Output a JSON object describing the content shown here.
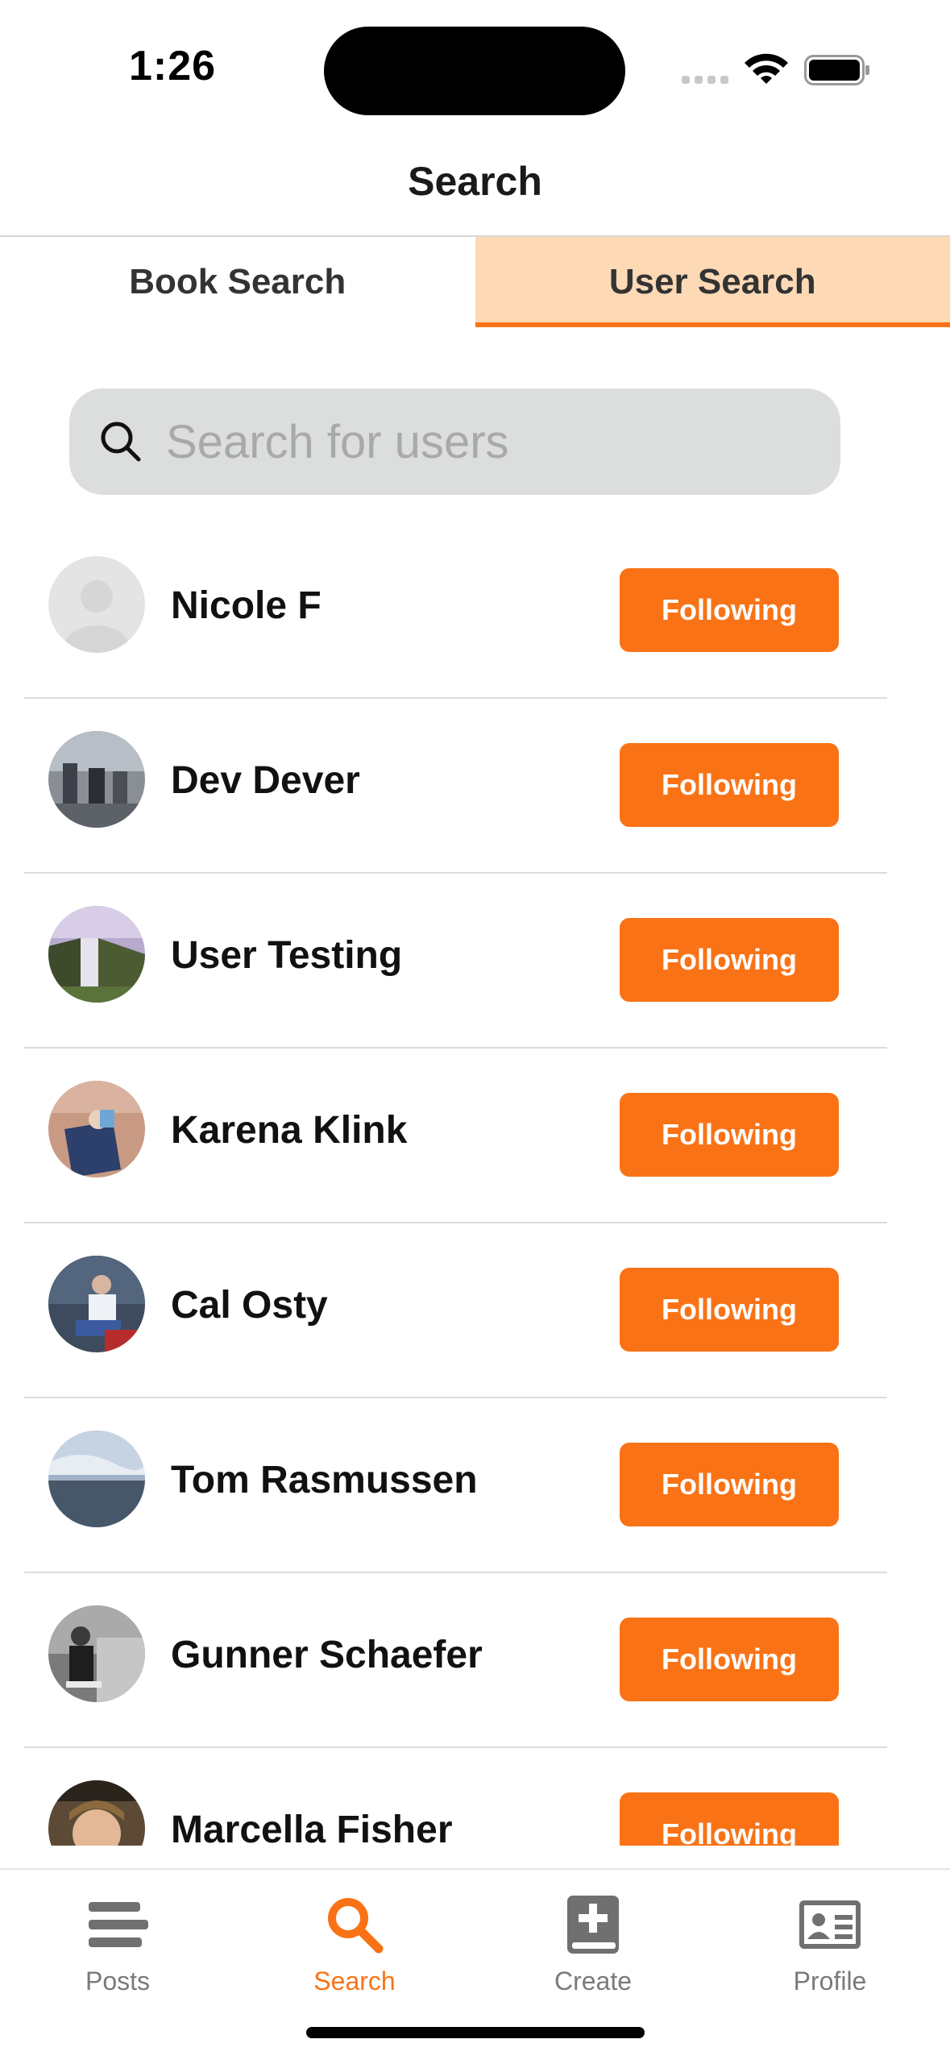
{
  "status_bar": {
    "time": "1:26"
  },
  "nav": {
    "title": "Search"
  },
  "tabs": [
    {
      "label": "Book Search",
      "active": false
    },
    {
      "label": "User Search",
      "active": true
    }
  ],
  "search": {
    "placeholder": "Search for users",
    "value": ""
  },
  "users": [
    {
      "name": "Nicole F",
      "button_label": "Following",
      "avatar": "placeholder-person-icon"
    },
    {
      "name": "Dev Dever",
      "button_label": "Following",
      "avatar": "photo"
    },
    {
      "name": "User Testing",
      "button_label": "Following",
      "avatar": "photo"
    },
    {
      "name": "Karena Klink",
      "button_label": "Following",
      "avatar": "photo"
    },
    {
      "name": "Cal Osty",
      "button_label": "Following",
      "avatar": "photo"
    },
    {
      "name": "Tom Rasmussen",
      "button_label": "Following",
      "avatar": "photo"
    },
    {
      "name": "Gunner Schaefer",
      "button_label": "Following",
      "avatar": "photo"
    },
    {
      "name": "Marcella Fisher",
      "button_label": "Following",
      "avatar": "photo"
    }
  ],
  "tab_bar": {
    "items": [
      {
        "label": "Posts",
        "icon": "posts-icon",
        "active": false
      },
      {
        "label": "Search",
        "icon": "search-icon",
        "active": true
      },
      {
        "label": "Create",
        "icon": "create-book-icon",
        "active": false
      },
      {
        "label": "Profile",
        "icon": "profile-card-icon",
        "active": false
      }
    ]
  },
  "colors": {
    "accent": "#f97316",
    "active_tab_bg": "#fdd9b6",
    "search_bg": "#dcdddd"
  }
}
